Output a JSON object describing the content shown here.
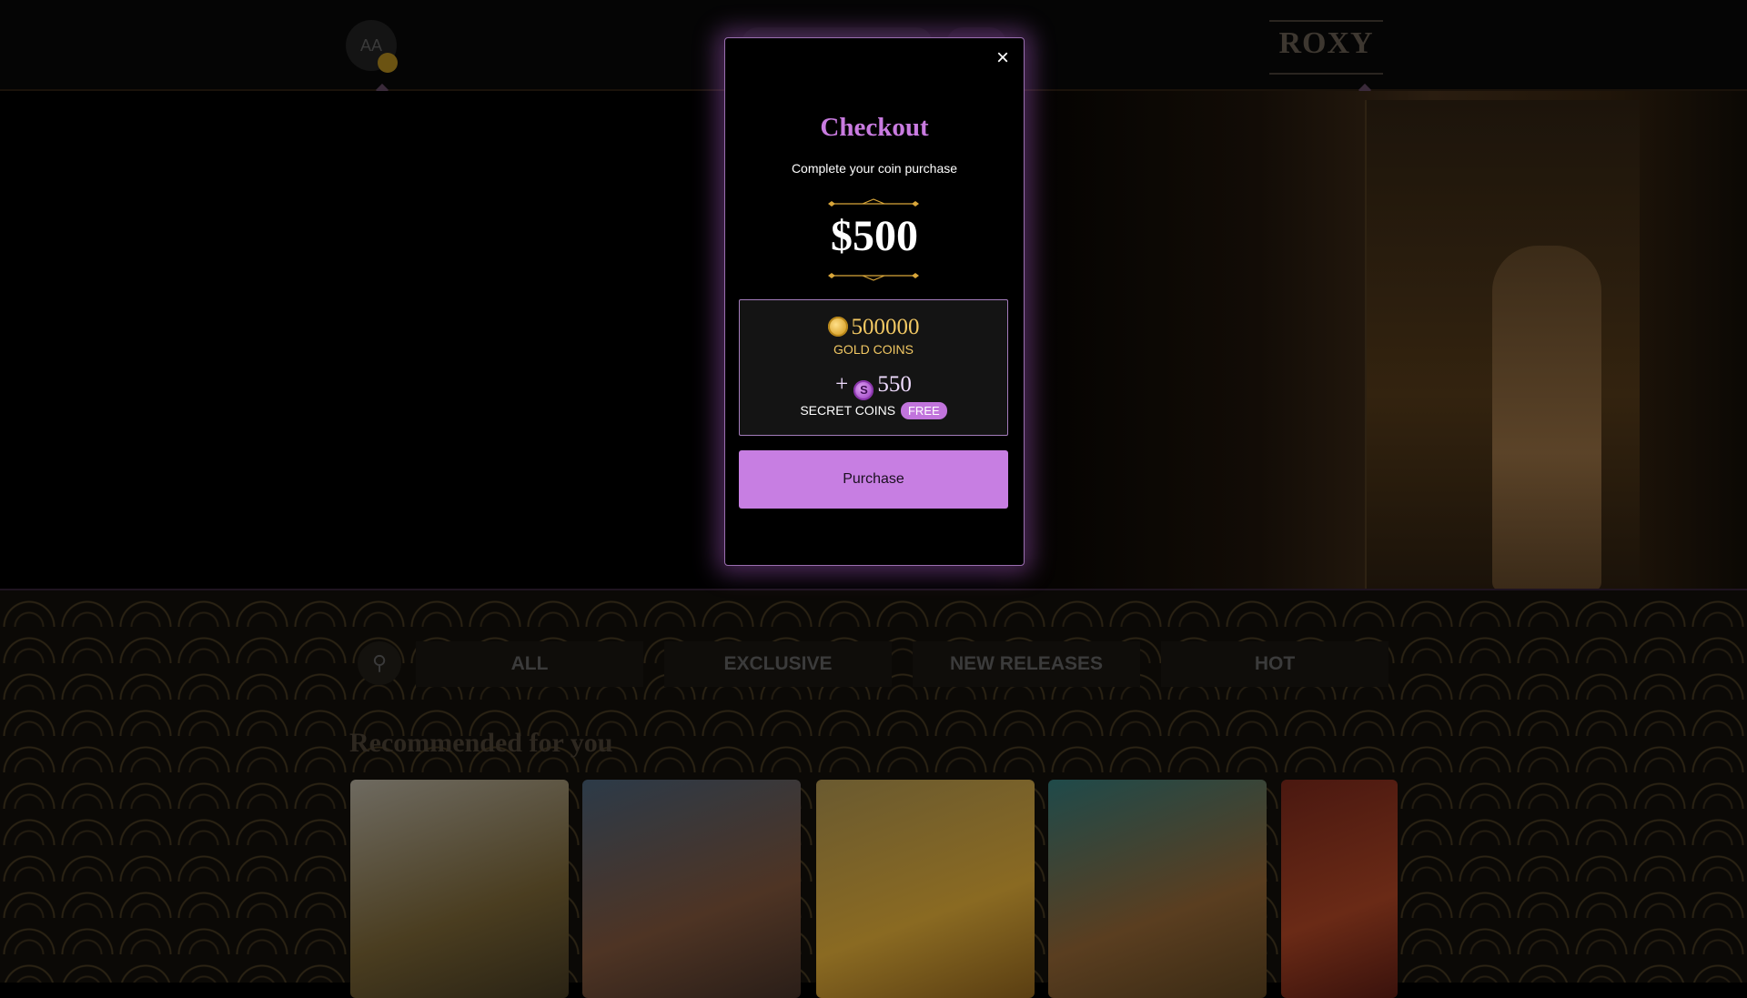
{
  "background": {
    "header": {
      "avatar_initials": "AA",
      "logo_text": "ROXY"
    },
    "tabs": [
      "ALL",
      "EXCLUSIVE",
      "NEW RELEASES",
      "HOT"
    ],
    "section_title": "Recommended for you"
  },
  "modal": {
    "title": "Checkout",
    "subtitle": "Complete your coin purchase",
    "price": "$500",
    "gold": {
      "amount": "500000",
      "label": "GOLD COINS"
    },
    "secret": {
      "prefix": "+",
      "amount": "550",
      "label": "SECRET COINS",
      "badge": "FREE"
    },
    "purchase_label": "Purchase",
    "close_icon": "×"
  },
  "colors": {
    "accent": "#c77ee2",
    "gold": "#f2c863",
    "title": "#c97be0"
  }
}
